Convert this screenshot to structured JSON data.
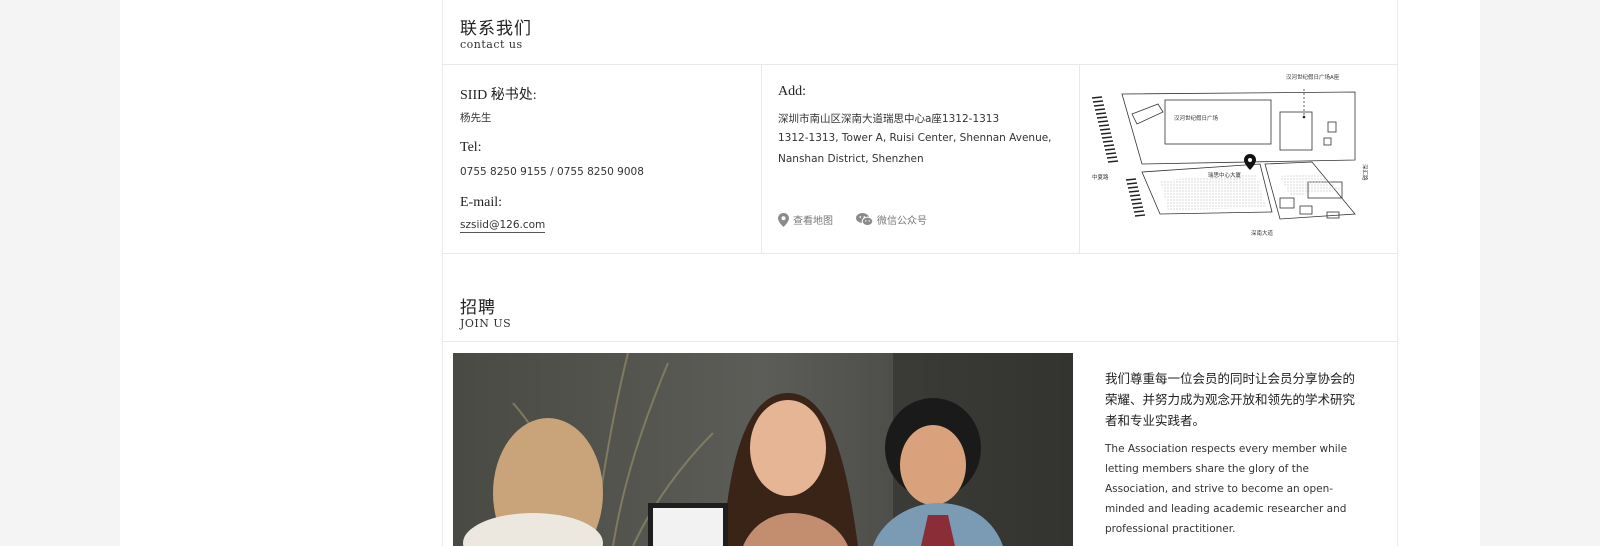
{
  "contact": {
    "title_zh": "联系我们",
    "title_en": "contact us",
    "office_label": "SIID 秘书处:",
    "office_person": "杨先生",
    "tel_label": "Tel:",
    "tel_value": "0755 8250 9155 / 0755 8250 9008",
    "email_label": "E-mail:",
    "email_value": "szsiid@126.com",
    "add_label": "Add:",
    "address_zh": "深圳市南山区深南大道瑞思中心a座1312-1313",
    "address_en_1": "1312-1313, Tower A, Ruisi Center, Shennan Avenue,",
    "address_en_2": "Nanshan District, Shenzhen",
    "map_link": "查看地图",
    "wechat_link": "微信公众号"
  },
  "map": {
    "label_top": "汉河世纪假日广场A座",
    "label_plaza": "汉河世纪假日广场",
    "label_center": "瑞思中心大厦",
    "label_left": "中夏路",
    "label_bottom": "深南大道",
    "label_right": "深汇路"
  },
  "join": {
    "title_zh": "招聘",
    "title_en": "JOIN US",
    "text_zh": "我们尊重每一位会员的同时让会员分享协会的荣耀、并努力成为观念开放和领先的学术研究者和专业实践者。",
    "text_en": "The Association respects every member while letting members share the glory of the Association, and strive to become an open-minded and leading academic researcher and professional practitioner."
  }
}
